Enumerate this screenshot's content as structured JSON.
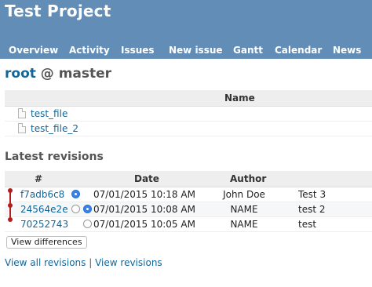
{
  "header": {
    "project_title": "Test Project",
    "menu": [
      "Overview",
      "Activity",
      "Issues",
      "New issue",
      "Gantt",
      "Calendar",
      "News"
    ]
  },
  "repository": {
    "root": "root",
    "separator": "@",
    "branch": "master"
  },
  "files": {
    "column_header": "Name",
    "items": [
      "test_file",
      "test_file_2"
    ]
  },
  "revisions": {
    "title": "Latest revisions",
    "columns": {
      "id": "#",
      "date": "Date",
      "author": "Author"
    },
    "rows": [
      {
        "id": "f7adb6c8",
        "date": "07/01/2015 10:18 AM",
        "author": "John Doe",
        "comment": "Test 3"
      },
      {
        "id": "24564e2e",
        "date": "07/01/2015 10:08 AM",
        "author": "NAME",
        "comment": "test 2"
      },
      {
        "id": "70252743",
        "date": "07/01/2015 10:05 AM",
        "author": "NAME",
        "comment": "test"
      }
    ],
    "view_differences_label": "View differences"
  },
  "links": {
    "view_all": "View all revisions",
    "separator": "|",
    "view_revisions": "View revisions"
  },
  "colors": {
    "header_bg": "#628db6",
    "link": "#116699",
    "graph": "#b01e1e",
    "radio_checked": "#3b82e6"
  }
}
